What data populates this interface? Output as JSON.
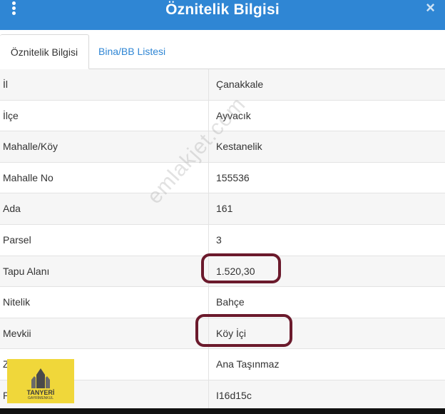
{
  "window": {
    "title": "Öznitelik Bilgisi",
    "close_glyph": "×"
  },
  "tabs": [
    {
      "label": "Öznitelik Bilgisi",
      "active": true
    },
    {
      "label": "Bina/BB Listesi",
      "active": false
    }
  ],
  "attributes": [
    {
      "key": "İl",
      "value": "Çanakkale"
    },
    {
      "key": "İlçe",
      "value": "Ayvacık"
    },
    {
      "key": "Mahalle/Köy",
      "value": "Kestanelik"
    },
    {
      "key": "Mahalle No",
      "value": "155536"
    },
    {
      "key": "Ada",
      "value": "161"
    },
    {
      "key": "Parsel",
      "value": "3"
    },
    {
      "key": "Tapu Alanı",
      "value": "1.520,30"
    },
    {
      "key": "Nitelik",
      "value": "Bahçe"
    },
    {
      "key": "Mevkii",
      "value": "Köy İçi"
    },
    {
      "key": "Zemin Tip",
      "value": "Ana Taşınmaz"
    },
    {
      "key": "Pafta",
      "value": "I16d15c"
    }
  ],
  "watermark": "emlakjet.com",
  "logo": {
    "name": "TANYERİ",
    "subtitle": "GAYRİMENKUL"
  },
  "colors": {
    "header": "#2f86d4",
    "annotation": "#6b1a2c",
    "logo_bg": "#f0d73a"
  }
}
